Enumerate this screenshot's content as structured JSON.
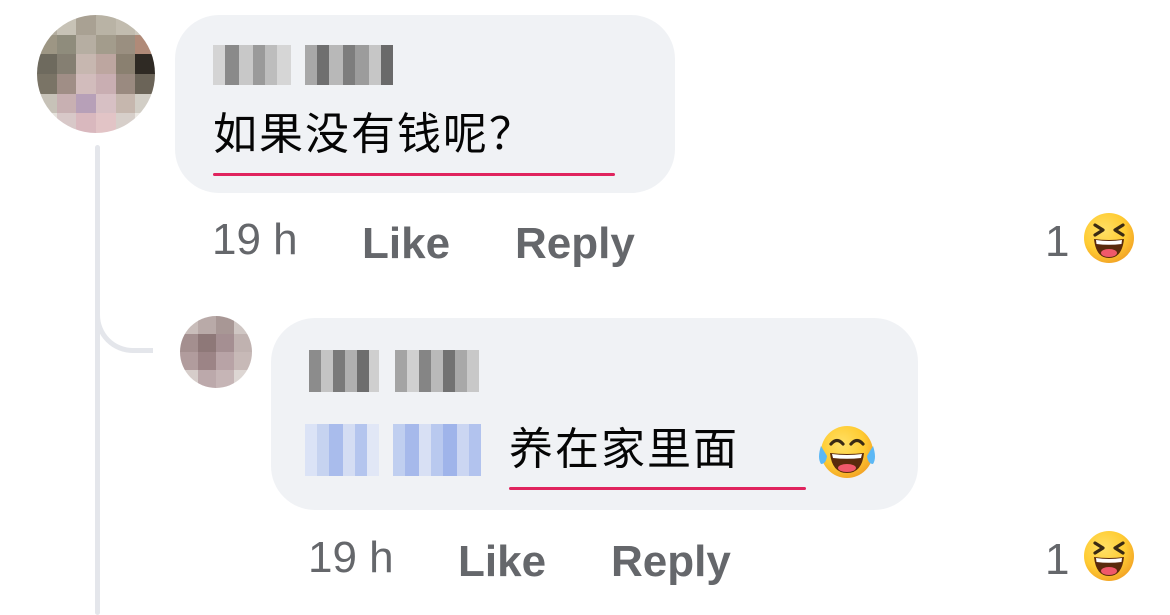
{
  "comments": [
    {
      "author_pixelated": true,
      "text": "如果没有钱呢？",
      "time": "19 h",
      "like_label": "Like",
      "reply_label": "Reply",
      "reaction_count": "1",
      "reaction_icon": "laughing-emoji-icon"
    },
    {
      "author_pixelated": true,
      "mention_pixelated": true,
      "text": "养在家里面",
      "text_emoji": "tears-of-joy-emoji-icon",
      "time": "19 h",
      "like_label": "Like",
      "reply_label": "Reply",
      "reaction_count": "1",
      "reaction_icon": "laughing-emoji-icon"
    }
  ],
  "colors": {
    "bubble": "#f0f2f5",
    "meta_text": "#65676b",
    "body_text": "#050505",
    "spellcheck_underline": "#e0245e",
    "thread_line": "#e4e6eb",
    "mention_blue_tint": "#b7c8ee"
  }
}
